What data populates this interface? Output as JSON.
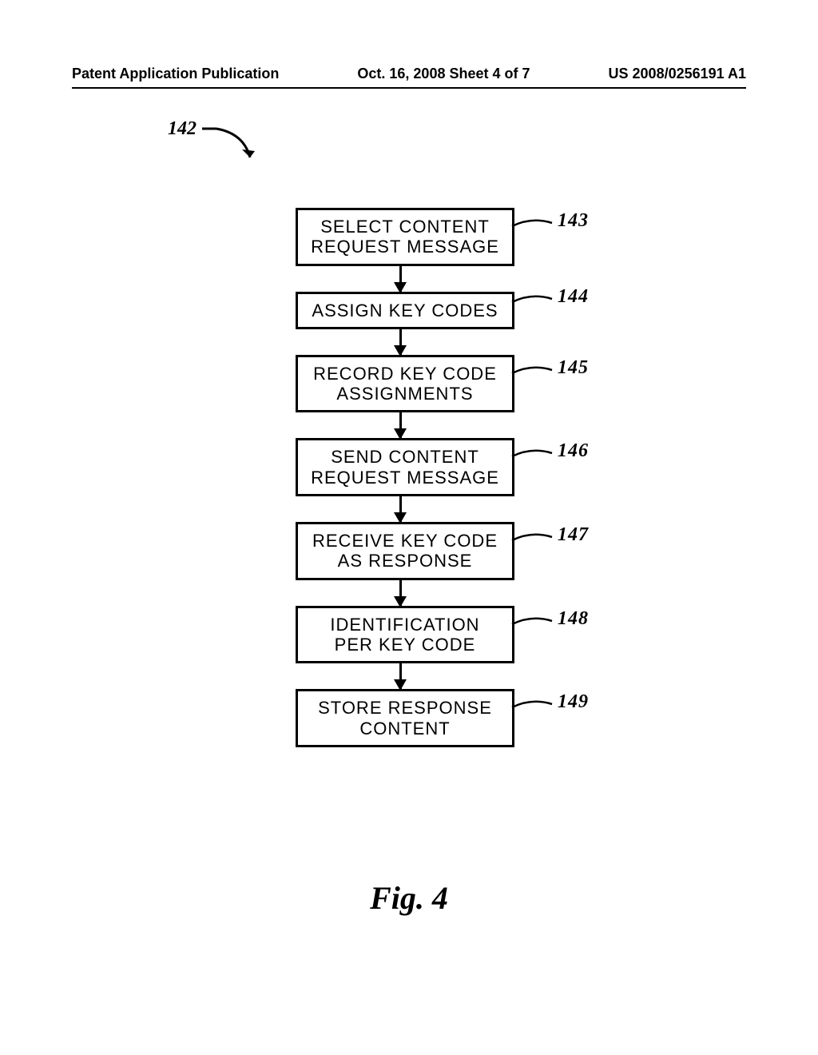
{
  "header": {
    "left": "Patent Application Publication",
    "center": "Oct. 16, 2008  Sheet 4 of 7",
    "right": "US 2008/0256191 A1"
  },
  "figure": {
    "entry_ref": "142",
    "caption": "Fig.  4",
    "steps": [
      {
        "ref": "143",
        "line1": "SELECT CONTENT",
        "line2": "REQUEST MESSAGE"
      },
      {
        "ref": "144",
        "line1": "ASSIGN KEY CODES",
        "line2": ""
      },
      {
        "ref": "145",
        "line1": "RECORD KEY CODE",
        "line2": "ASSIGNMENTS"
      },
      {
        "ref": "146",
        "line1": "SEND CONTENT",
        "line2": "REQUEST MESSAGE"
      },
      {
        "ref": "147",
        "line1": "RECEIVE KEY CODE",
        "line2": "AS RESPONSE"
      },
      {
        "ref": "148",
        "line1": "IDENTIFICATION",
        "line2": "PER KEY CODE"
      },
      {
        "ref": "149",
        "line1": "STORE RESPONSE",
        "line2": "CONTENT"
      }
    ]
  }
}
